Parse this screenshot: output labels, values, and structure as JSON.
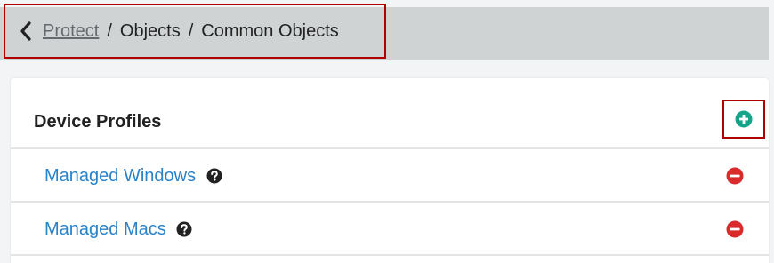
{
  "breadcrumb": {
    "back_icon": "chevron-left-icon",
    "root_link": "Protect",
    "separator": "/",
    "level2": "Objects",
    "current": "Common Objects"
  },
  "card": {
    "title": "Device Profiles",
    "add_icon": "plus-circle-icon",
    "items": [
      {
        "label": "Managed Windows",
        "help_icon": "question-circle-icon",
        "remove_icon": "minus-circle-icon"
      },
      {
        "label": "Managed Macs",
        "help_icon": "question-circle-icon",
        "remove_icon": "minus-circle-icon"
      }
    ]
  },
  "colors": {
    "link": "#2a82c9",
    "add": "#17a589",
    "remove": "#d92b2b",
    "highlight_frame": "#b00000",
    "header_bg": "#d0d3d4"
  }
}
